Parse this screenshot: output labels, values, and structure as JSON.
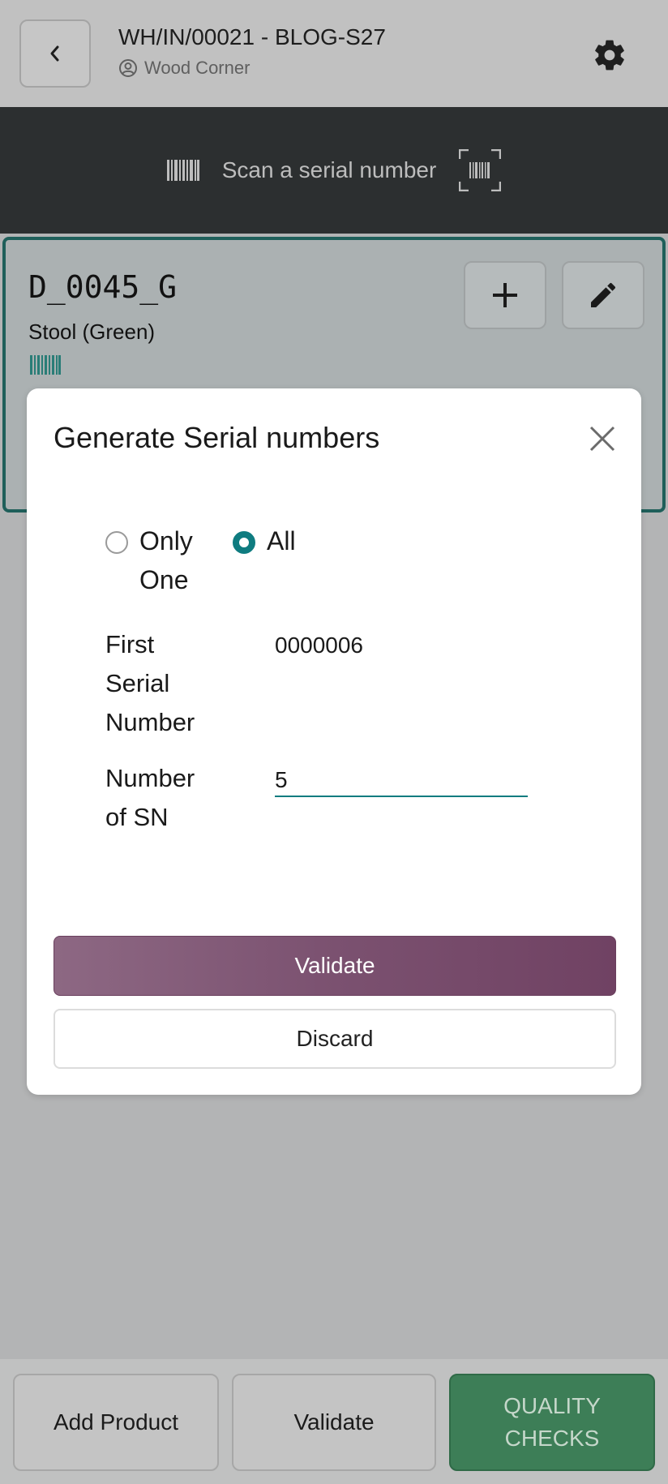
{
  "header": {
    "title": "WH/IN/00021 - BLOG-S27",
    "partner": "Wood Corner"
  },
  "scanbar": {
    "text": "Scan a serial number"
  },
  "card": {
    "code": "D_0045_G",
    "product": "Stool (Green)"
  },
  "modal": {
    "title": "Generate Serial numbers",
    "options": [
      {
        "label": "Only One",
        "checked": false
      },
      {
        "label": "All",
        "checked": true
      }
    ],
    "first_serial_label": "First Serial Number",
    "first_serial_value": "0000006",
    "number_label": "Number of SN",
    "number_value": "5",
    "validate_label": "Validate",
    "discard_label": "Discard"
  },
  "footer": {
    "add_product": "Add Product",
    "validate": "Validate",
    "quality_checks": "QUALITY CHECKS"
  },
  "colors": {
    "accent_teal": "#0f7c80",
    "primary_purple": "#7b5170",
    "quality_green": "#3d7e57",
    "scanbar_dark": "#2c2f30"
  }
}
